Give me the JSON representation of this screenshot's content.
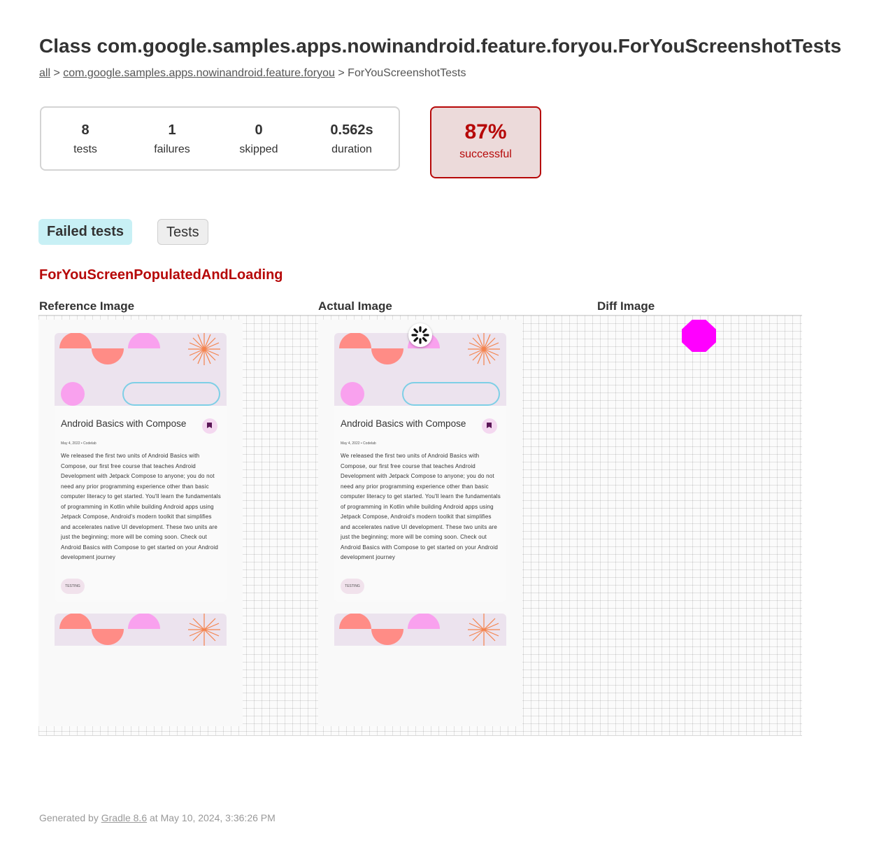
{
  "page": {
    "title": "Class com.google.samples.apps.nowinandroid.feature.foryou.ForYouScreenshotTests",
    "breadcrumb": {
      "all": "all",
      "sep1": " > ",
      "package": "com.google.samples.apps.nowinandroid.feature.foryou",
      "sep2": " > ",
      "current": "ForYouScreenshotTests"
    }
  },
  "summary": {
    "tests": {
      "value": "8",
      "label": "tests"
    },
    "failures": {
      "value": "1",
      "label": "failures"
    },
    "skipped": {
      "value": "0",
      "label": "skipped"
    },
    "duration": {
      "value": "0.562s",
      "label": "duration"
    },
    "success_rate": {
      "value": "87%",
      "label": "successful"
    }
  },
  "tabs": [
    {
      "label": "Failed tests",
      "selected": true
    },
    {
      "label": "Tests",
      "selected": false
    }
  ],
  "failed_test": {
    "name": "ForYouScreenPopulatedAndLoading",
    "columns": [
      "Reference Image",
      "Actual Image",
      "Diff Image"
    ]
  },
  "card": {
    "title": "Android Basics with Compose",
    "meta": "May 4, 2022 • Codelab",
    "body": "We released the first two units of Android Basics with Compose, our first free course that teaches Android Development with Jetpack Compose to anyone; you do not need any prior programming experience other than basic computer literacy to get started. You'll learn the fundamentals of programming in Kotlin while building Android apps using Jetpack Compose, Android's modern toolkit that simplifies and accelerates native UI development. These two units are just the beginning; more will be coming soon. Check out Android Basics with Compose to get started on your Android development journey",
    "chip": "TESTING"
  },
  "colors": {
    "failure_red": "#b60808",
    "success_box_bg": "#ecdada",
    "tab_selected_bg": "#c8f0f5",
    "diff_magenta": "#ff00ff",
    "art_bg": "#ece3ee",
    "art_coral": "#ff8c86",
    "art_pink": "#f9a1ee",
    "art_sun": "#f4834d",
    "art_outline": "#7ecfe6"
  },
  "footer": {
    "prefix": "Generated by ",
    "gradle": "Gradle 8.6",
    "suffix": " at May 10, 2024, 3:36:26 PM"
  }
}
